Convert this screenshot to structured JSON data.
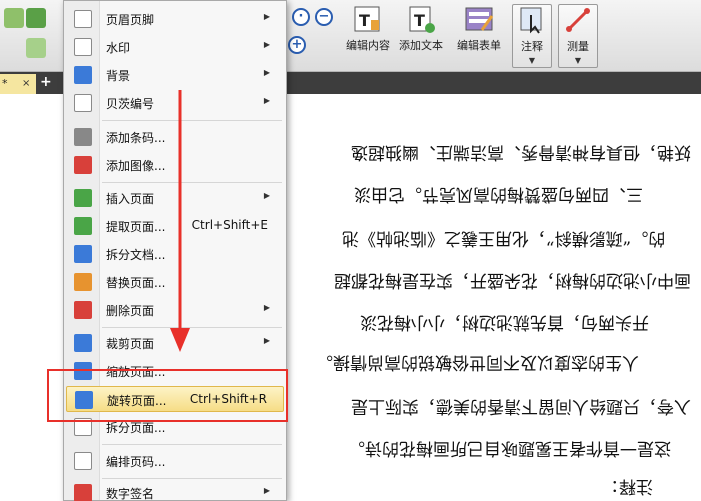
{
  "toolbar": {
    "tools": [
      {
        "label": "编辑内容",
        "icon": "edit-content-icon"
      },
      {
        "label": "添加文本",
        "icon": "add-text-icon"
      },
      {
        "label": "编辑表单",
        "icon": "edit-form-icon"
      },
      {
        "label": "注释",
        "icon": "comment-icon"
      },
      {
        "label": "测量",
        "icon": "measure-icon"
      }
    ]
  },
  "tabs": {
    "doc_tab_label": "*",
    "close_glyph": "×",
    "add_glyph": "+"
  },
  "document": {
    "lines": [
      "妖艳，但具有神清骨秀、高洁端庄、幽独超逸",
      "三、四两句盛赞梅的高风亮节。它由淡",
      "的。“疏影横斜”，化用王羲之《临池帖》池",
      "画中小池边的梅树，花朵盛开，实在是梅花都超",
      "开头两句，首先就池边树，小小梅花淡",
      "人生的态度以及不同世俗敏锐的高尚情操。",
      "入夸，只题给人间留下清香的美德，实际上是",
      "这是一首作者王冕题咏自己所画梅花的诗。",
      "注释："
    ]
  },
  "menu": {
    "items": [
      {
        "label": "页眉页脚",
        "shortcut": "",
        "submenu": true,
        "icon": "header-footer-icon"
      },
      {
        "label": "水印",
        "shortcut": "",
        "submenu": true,
        "icon": "watermark-icon"
      },
      {
        "label": "背景",
        "shortcut": "",
        "submenu": true,
        "icon": "background-icon"
      },
      {
        "label": "贝茨编号",
        "shortcut": "",
        "submenu": true,
        "icon": "bates-number-icon"
      },
      {
        "label": "添加条码...",
        "shortcut": "",
        "submenu": false,
        "icon": "barcode-icon"
      },
      {
        "label": "添加图像...",
        "shortcut": "",
        "submenu": false,
        "icon": "add-image-icon"
      },
      {
        "label": "插入页面",
        "shortcut": "",
        "submenu": true,
        "icon": "insert-page-icon"
      },
      {
        "label": "提取页面...",
        "shortcut": "Ctrl+Shift+E",
        "submenu": false,
        "icon": "extract-page-icon"
      },
      {
        "label": "拆分文档...",
        "shortcut": "",
        "submenu": false,
        "icon": "split-document-icon"
      },
      {
        "label": "替换页面...",
        "shortcut": "",
        "submenu": false,
        "icon": "replace-page-icon"
      },
      {
        "label": "删除页面",
        "shortcut": "",
        "submenu": true,
        "icon": "delete-page-icon"
      },
      {
        "label": "裁剪页面",
        "shortcut": "",
        "submenu": true,
        "icon": "crop-page-icon"
      },
      {
        "label": "缩放页面...",
        "shortcut": "",
        "submenu": false,
        "icon": "scale-page-icon"
      },
      {
        "label": "旋转页面...",
        "shortcut": "Ctrl+Shift+R",
        "submenu": false,
        "icon": "rotate-page-icon"
      },
      {
        "label": "拆分页面...",
        "shortcut": "",
        "submenu": false,
        "icon": "split-page-icon"
      },
      {
        "label": "编排页码...",
        "shortcut": "",
        "submenu": false,
        "icon": "page-number-icon"
      },
      {
        "label": "数字签名",
        "shortcut": "",
        "submenu": true,
        "icon": "digital-signature-icon"
      }
    ],
    "submenu_glyph": "▶",
    "highlighted_index": 13
  },
  "colors": {
    "highlight_border": "#e8302a",
    "arrow": "#e8302a",
    "hover_fill": "#f6dd86"
  }
}
